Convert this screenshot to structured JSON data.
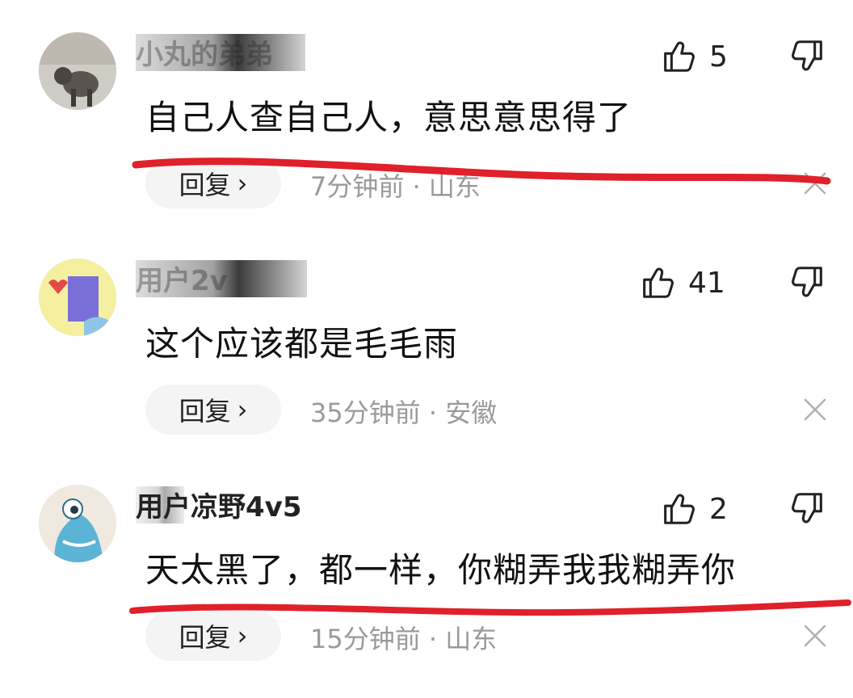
{
  "comments": [
    {
      "username": "小丸的弟弟",
      "text": "自己人查自己人，意思意思得了",
      "likes": "5",
      "reply_label": "回复",
      "reply_chevron": "›",
      "time": "7分钟前",
      "separator": "·",
      "location": "山东",
      "avatar_icon": "dog-photo-avatar"
    },
    {
      "username": "用户2v",
      "text": "这个应该都是毛毛雨",
      "likes": "41",
      "reply_label": "回复",
      "reply_chevron": "›",
      "time": "35分钟前",
      "separator": "·",
      "location": "安徽",
      "avatar_icon": "cartoon-avatar"
    },
    {
      "username": "用户凉野4v5",
      "text": "天太黑了，都一样，你糊弄我我糊弄你",
      "likes": "2",
      "reply_label": "回复",
      "reply_chevron": "›",
      "time": "15分钟前",
      "separator": "·",
      "location": "山东",
      "avatar_icon": "blue-monster-avatar"
    }
  ],
  "colors": {
    "annotation_red": "#e0202a",
    "meta_gray": "#9a9a9a",
    "pill_bg": "#f4f4f4"
  }
}
